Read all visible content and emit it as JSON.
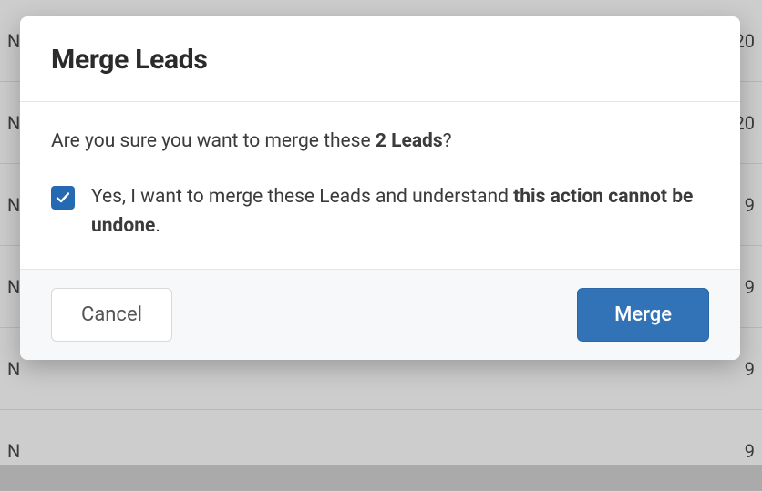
{
  "background": {
    "rows": [
      {
        "left": "N..",
        "right": "01/20/2020"
      },
      {
        "left": "N",
        "right": "20"
      },
      {
        "left": "N",
        "right": "9"
      },
      {
        "left": "N",
        "right": "9"
      },
      {
        "left": "N",
        "right": "9"
      },
      {
        "left": "N",
        "right": "9"
      }
    ]
  },
  "modal": {
    "title": "Merge Leads",
    "confirm_prefix": "Are you sure you want to merge these ",
    "confirm_bold": "2 Leads",
    "confirm_suffix": "?",
    "checkbox_checked": true,
    "check_label_prefix": "Yes, I want to merge these Leads and understand ",
    "check_label_bold": "this action cannot be undone",
    "check_label_suffix": ".",
    "cancel_label": "Cancel",
    "merge_label": "Merge"
  }
}
